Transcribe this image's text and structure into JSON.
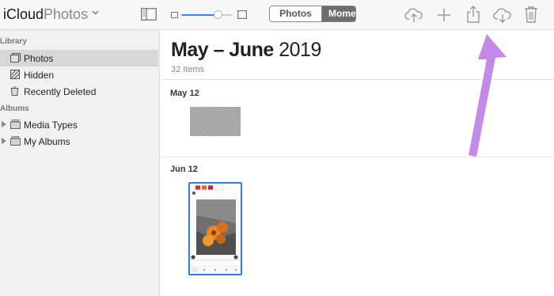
{
  "app": {
    "brand": "iCloud",
    "name": "Photos"
  },
  "toolbar": {
    "zoom_level": 0.73,
    "tabs": [
      {
        "label": "Photos",
        "selected": false
      },
      {
        "label": "Mome",
        "selected": true
      }
    ],
    "icons": [
      "upload-icon",
      "add-icon",
      "share-icon",
      "download-icon",
      "trash-icon"
    ]
  },
  "sidebar": {
    "sections": [
      {
        "title": "Library",
        "items": [
          {
            "label": "Photos",
            "icon": "photos-icon",
            "selected": true
          },
          {
            "label": "Hidden",
            "icon": "hidden-icon",
            "selected": false
          },
          {
            "label": "Recently Deleted",
            "icon": "trash-icon",
            "selected": false
          }
        ]
      },
      {
        "title": "Albums",
        "items": [
          {
            "label": "Media Types",
            "icon": "album-stack-icon",
            "expandable": true
          },
          {
            "label": "My Albums",
            "icon": "album-stack-icon",
            "expandable": true
          }
        ]
      }
    ]
  },
  "main": {
    "title_range": "May – June",
    "title_year": "2019",
    "item_count": "32 Items",
    "groups": [
      {
        "date": "May 12",
        "photos": 1
      },
      {
        "date": "Jun 12",
        "photos": 1,
        "selected": true
      }
    ]
  },
  "colors": {
    "selection_blue": "#2f7de1",
    "annotation_arrow": "#c07fe6",
    "selected_tab": "#6d6d6d"
  }
}
